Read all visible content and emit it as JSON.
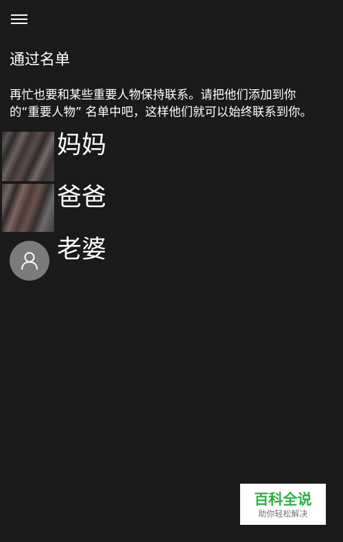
{
  "header": {
    "menu_icon": "hamburger-icon"
  },
  "page": {
    "title": "通过名单",
    "description": "再忙也要和某些重要人物保持联系。请把他们添加到你\n的“重要人物” 名单中吧，这样他们就可以始终联系到你。"
  },
  "contacts": [
    {
      "name": "妈妈",
      "avatar": "photo"
    },
    {
      "name": "爸爸",
      "avatar": "photo"
    },
    {
      "name": "老婆",
      "avatar": "person-icon"
    }
  ],
  "watermark": {
    "title": "百科全说",
    "subtitle": "助你轻松解决"
  },
  "colors": {
    "background": "#1a1a1a",
    "text": "#ffffff",
    "avatar_placeholder": "#7b7b7b",
    "watermark_green": "#27b340"
  }
}
